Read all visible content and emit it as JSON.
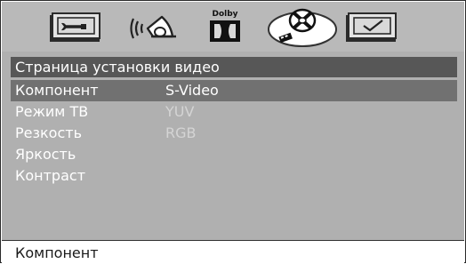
{
  "tabs": [
    {
      "name": "general",
      "icon": "wrench-icon"
    },
    {
      "name": "audio",
      "icon": "speaker-icon"
    },
    {
      "name": "dolby",
      "icon": "dolby-icon",
      "text": "Dolby"
    },
    {
      "name": "video",
      "icon": "video-disc-icon",
      "selected": true
    },
    {
      "name": "preference",
      "icon": "checkmark-icon"
    }
  ],
  "page": {
    "title": "Страница установки видео"
  },
  "menu": {
    "items": [
      {
        "label": "Компонент"
      },
      {
        "label": "Режим ТВ"
      },
      {
        "label": "Резкость"
      },
      {
        "label": "Яркость"
      },
      {
        "label": "Контраст"
      }
    ]
  },
  "options": [
    {
      "label": "S-Video",
      "active": true
    },
    {
      "label": "YUV",
      "active": false
    },
    {
      "label": "RGB",
      "active": false
    }
  ],
  "status": {
    "text": "Компонент"
  },
  "colors": {
    "topbar": "#b9b9b9",
    "panel": "#b0b0b0",
    "title_bar": "#575757",
    "highlight": "#717171"
  }
}
